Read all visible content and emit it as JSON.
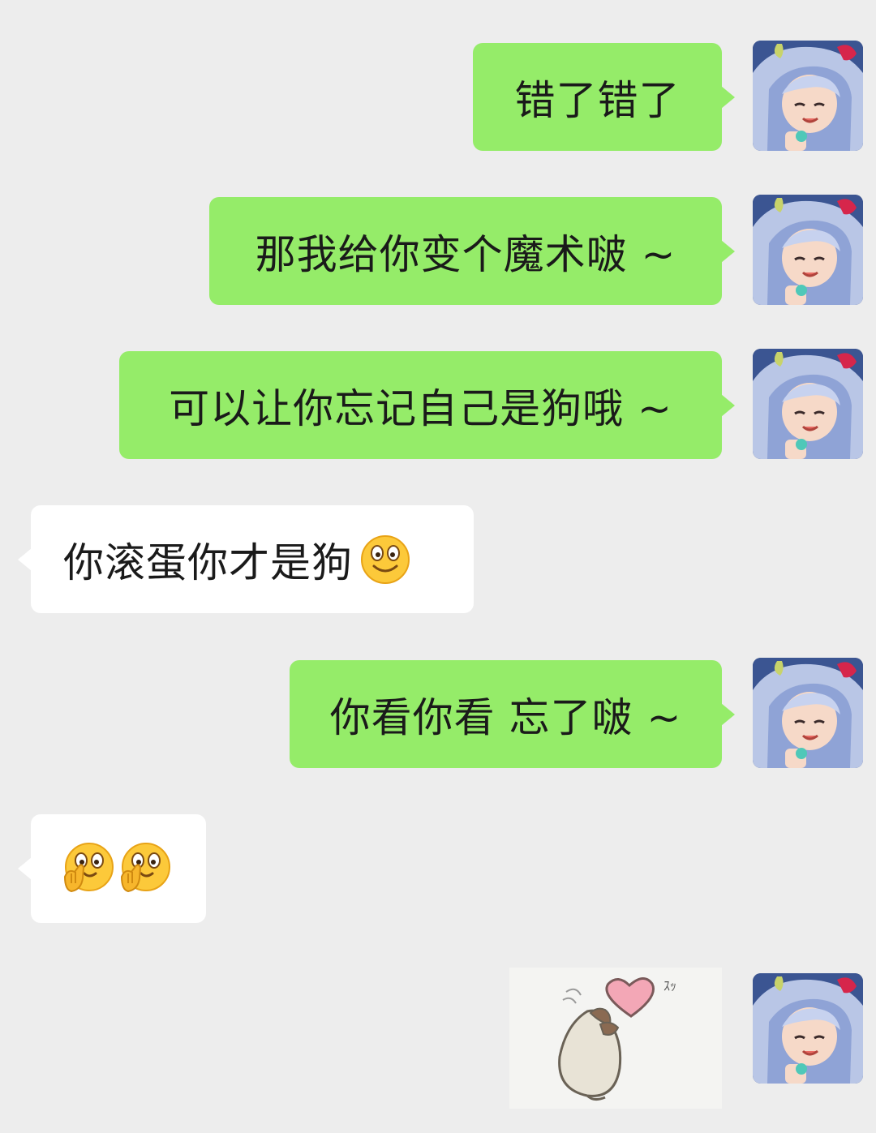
{
  "messages": [
    {
      "side": "out",
      "text": "错了错了",
      "avatar_icon": "anime-girl-avatar-icon"
    },
    {
      "side": "out",
      "text": "那我给你变个魔术啵 ~",
      "avatar_icon": "anime-girl-avatar-icon"
    },
    {
      "side": "out",
      "text": "可以让你忘记自己是狗哦 ~",
      "avatar_icon": "anime-girl-avatar-icon"
    },
    {
      "side": "in",
      "text": "你滚蛋你才是狗",
      "emoji": "smile-emoji-icon"
    },
    {
      "side": "out",
      "text": "你看你看 忘了啵 ~",
      "avatar_icon": "anime-girl-avatar-icon"
    },
    {
      "side": "in",
      "text": "",
      "emojis": [
        "cover-face-emoji-icon",
        "cover-face-emoji-icon"
      ]
    },
    {
      "side": "out",
      "type": "sticker",
      "sticker": "hamster-heart-sticker",
      "sticker_text": "ｽｯ",
      "avatar_icon": "anime-girl-avatar-icon"
    }
  ],
  "colors": {
    "background": "#ededed",
    "outgoing_bubble": "#95ec69",
    "incoming_bubble": "#ffffff",
    "text": "#1a1a1a"
  }
}
